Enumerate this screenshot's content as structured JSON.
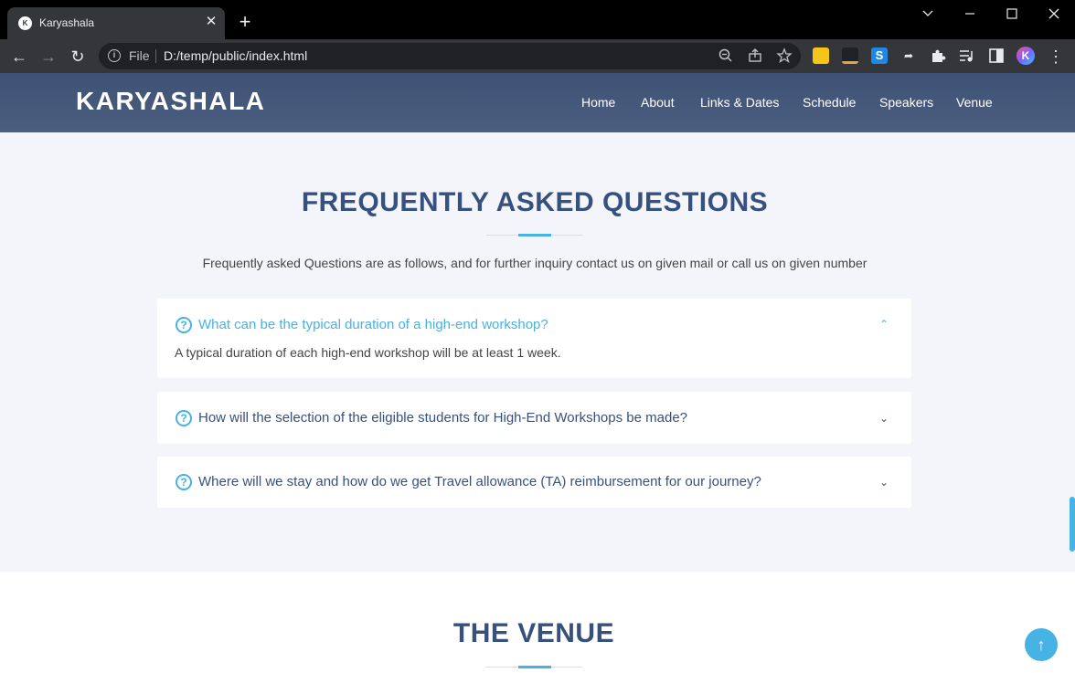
{
  "browser": {
    "tab_title": "Karyashala",
    "tab_close": "✕",
    "new_tab": "+",
    "file_label": "File",
    "url": "D:/temp/public/index.html"
  },
  "site": {
    "logo": "KARYASHALA",
    "nav": [
      "Home",
      "About",
      "Links & Dates",
      "Schedule",
      "Speakers",
      "Venue"
    ]
  },
  "faq": {
    "title": "FREQUENTLY ASKED QUESTIONS",
    "subtitle": "Frequently asked Questions are as follows, and for further inquiry contact us on given mail or call us on given number",
    "items": [
      {
        "question": "What can be the typical duration of a high-end workshop?",
        "answer": "A typical duration of each high-end workshop will be at least 1 week.",
        "expanded": true
      },
      {
        "question": "How will the selection of the eligible students for High-End Workshops be made?",
        "expanded": false
      },
      {
        "question": "Where will we stay and how do we get Travel allowance (TA) reimbursement for our journey?",
        "expanded": false
      }
    ]
  },
  "venue": {
    "title": "THE VENUE"
  },
  "colors": {
    "accent": "#47b2e4",
    "heading": "#37517e",
    "section_bg": "#f3f5fa",
    "header_bg": "#3e5275"
  }
}
